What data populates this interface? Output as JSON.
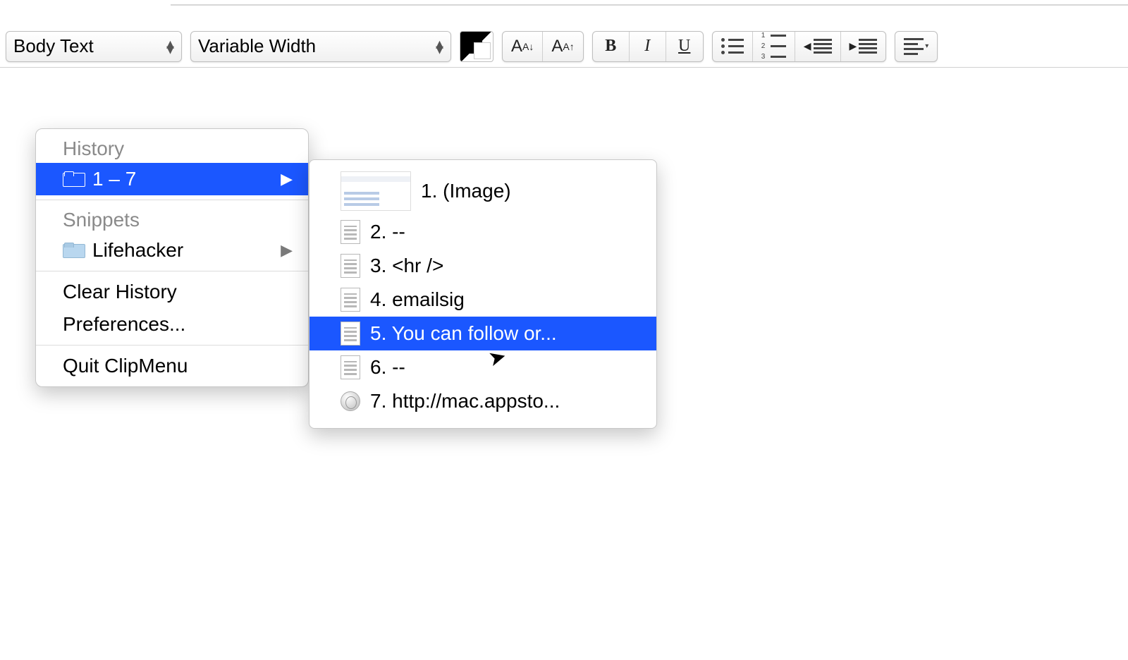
{
  "toolbar": {
    "style_label": "Body Text",
    "font_label": "Variable Width",
    "decrease_font_label": "A",
    "increase_font_label": "A",
    "bold_label": "B",
    "italic_label": "I",
    "underline_label": "U"
  },
  "menu": {
    "history_header": "History",
    "history_item_label": "1 – 7",
    "snippets_header": "Snippets",
    "snippets_item_label": "Lifehacker",
    "clear_history_label": "Clear History",
    "preferences_label": "Preferences...",
    "quit_label": "Quit ClipMenu"
  },
  "submenu": {
    "items": [
      {
        "text": "1. (Image)",
        "icon": "thumb"
      },
      {
        "text": "2. --",
        "icon": "doc"
      },
      {
        "text": "3. <hr />",
        "icon": "doc"
      },
      {
        "text": "4. emailsig",
        "icon": "doc"
      },
      {
        "text": "5. You can follow or...",
        "icon": "doc",
        "selected": true
      },
      {
        "text": "6. --",
        "icon": "doc"
      },
      {
        "text": "7. http://mac.appsto...",
        "icon": "globe"
      }
    ]
  }
}
